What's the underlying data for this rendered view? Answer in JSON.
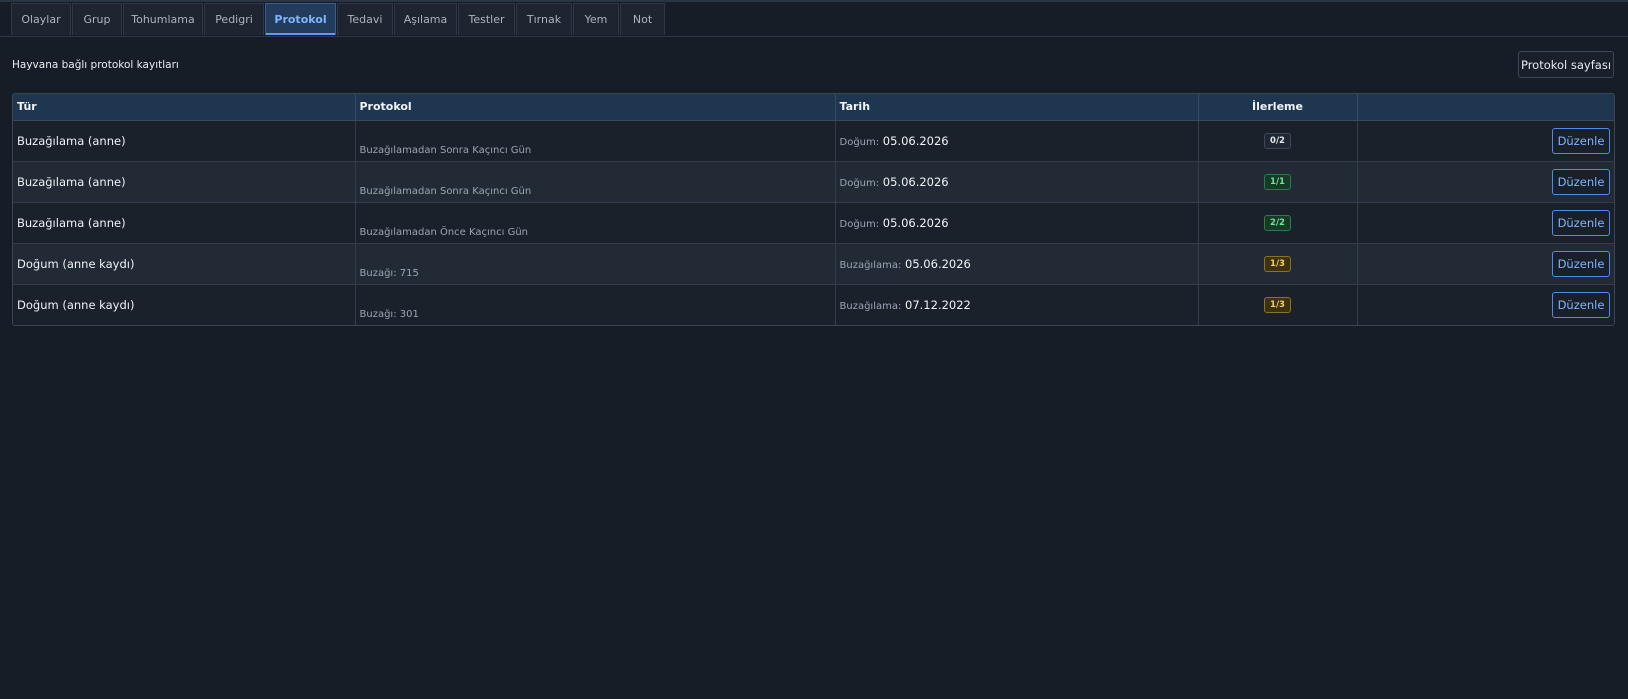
{
  "tabs": [
    {
      "label": "Olaylar",
      "active": false
    },
    {
      "label": "Grup",
      "active": false
    },
    {
      "label": "Tohumlama",
      "active": false
    },
    {
      "label": "Pedigri",
      "active": false
    },
    {
      "label": "Protokol",
      "active": true
    },
    {
      "label": "Tedavi",
      "active": false
    },
    {
      "label": "Aşılama",
      "active": false
    },
    {
      "label": "Testler",
      "active": false
    },
    {
      "label": "Tırnak",
      "active": false
    },
    {
      "label": "Yem",
      "active": false
    },
    {
      "label": "Not",
      "active": false
    }
  ],
  "toolbar": {
    "caption": "Hayvana bağlı protokol kayıtları",
    "protocol_page_label": "Protokol sayfası"
  },
  "table": {
    "headers": {
      "type": "Tür",
      "protocol": "Protokol",
      "date": "Tarih",
      "progress": "İlerleme",
      "actions": ""
    },
    "rows": [
      {
        "type": "Buzağılama (anne)",
        "protocol_sub": "Buzağılamadan Sonra Kaçıncı Gün",
        "date_label": "Doğum:",
        "date_value": "05.06.2026",
        "progress": "0/2",
        "progress_status": "neutral",
        "edit_label": "Düzenle"
      },
      {
        "type": "Buzağılama (anne)",
        "protocol_sub": "Buzağılamadan Sonra Kaçıncı Gün",
        "date_label": "Doğum:",
        "date_value": "05.06.2026",
        "progress": "1/1",
        "progress_status": "success",
        "edit_label": "Düzenle"
      },
      {
        "type": "Buzağılama (anne)",
        "protocol_sub": "Buzağılamadan Önce Kaçıncı Gün",
        "date_label": "Doğum:",
        "date_value": "05.06.2026",
        "progress": "2/2",
        "progress_status": "success",
        "edit_label": "Düzenle"
      },
      {
        "type": "Doğum (anne kaydı)",
        "protocol_sub": "Buzağı: 715",
        "date_label": "Buzağılama:",
        "date_value": "05.06.2026",
        "progress": "1/3",
        "progress_status": "warning",
        "edit_label": "Düzenle"
      },
      {
        "type": "Doğum (anne kaydı)",
        "protocol_sub": "Buzağı: 301",
        "date_label": "Buzağılama:",
        "date_value": "07.12.2022",
        "progress": "1/3",
        "progress_status": "warning",
        "edit_label": "Düzenle"
      }
    ]
  },
  "colors": {
    "background": "#171d26",
    "accent": "#5c9cf5",
    "header_bg": "#1e3650",
    "badge_success": "#6ee59a",
    "badge_warning": "#f7d154"
  }
}
